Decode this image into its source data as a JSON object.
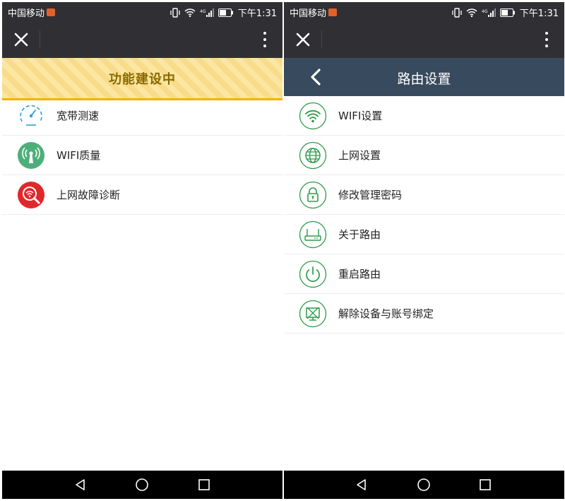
{
  "status_bar": {
    "carrier": "中国移动",
    "time": "下午1:31"
  },
  "left_screen": {
    "banner_text": "功能建设中",
    "items": [
      {
        "label": "宽带测速",
        "icon": "speedometer-icon",
        "color": "#2a9fd6"
      },
      {
        "label": "WIFI质量",
        "icon": "wifi-antenna-icon",
        "color": "#4caf7a"
      },
      {
        "label": "上网故障诊断",
        "icon": "wifi-search-icon",
        "color": "#e0282a"
      }
    ]
  },
  "right_screen": {
    "header_title": "路由设置",
    "items": [
      {
        "label": "WIFI设置",
        "icon": "wifi-icon"
      },
      {
        "label": "上网设置",
        "icon": "globe-icon"
      },
      {
        "label": "修改管理密码",
        "icon": "lock-icon"
      },
      {
        "label": "关于路由",
        "icon": "router-icon"
      },
      {
        "label": "重启路由",
        "icon": "power-icon"
      },
      {
        "label": "解除设备与账号绑定",
        "icon": "unbind-device-icon"
      }
    ],
    "icon_color": "#2d9b4a"
  },
  "colors": {
    "title_bar": "#303034",
    "router_header": "#374a5e",
    "banner_text": "#8a6a00",
    "banner_border": "#f0b400"
  }
}
